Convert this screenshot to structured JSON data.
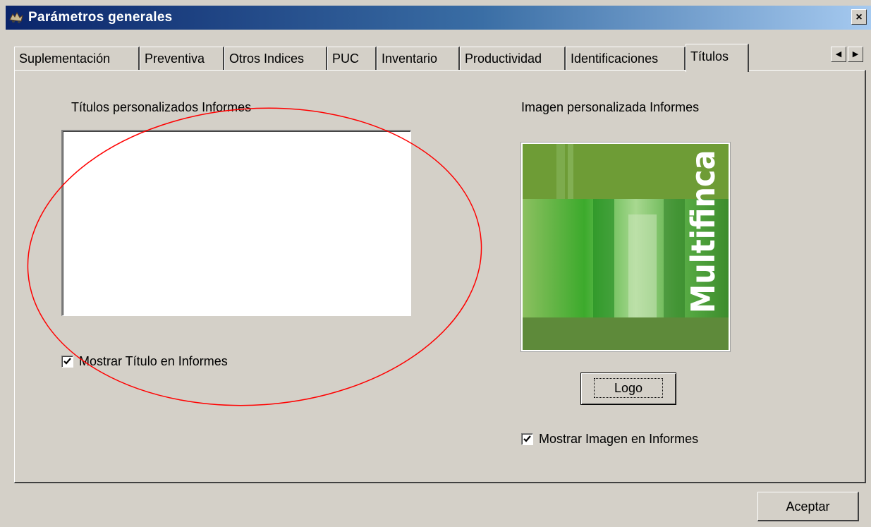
{
  "window": {
    "title": "Parámetros generales",
    "close_label": "×"
  },
  "tabs": [
    {
      "label": "Suplementación",
      "active": false
    },
    {
      "label": "Preventiva",
      "active": false
    },
    {
      "label": "Otros Indices",
      "active": false
    },
    {
      "label": "PUC",
      "active": false
    },
    {
      "label": "Inventario",
      "active": false
    },
    {
      "label": "Productividad",
      "active": false
    },
    {
      "label": "Identificaciones",
      "active": false
    },
    {
      "label": "Títulos",
      "active": true
    }
  ],
  "tab_scroll": {
    "left_icon": "◀",
    "right_icon": "▶"
  },
  "titulos_panel": {
    "custom_titles_label": "Títulos personalizados Informes",
    "custom_titles_value": "",
    "show_title_label": "Mostrar Título en Informes",
    "show_title_checked": true,
    "custom_image_label": "Imagen personalizada Informes",
    "image_text": "Multifinca",
    "logo_button_label": "Logo",
    "show_image_label": "Mostrar Imagen en Informes",
    "show_image_checked": true
  },
  "footer": {
    "accept_label": "Aceptar"
  },
  "colors": {
    "titlebar_start": "#0a246a",
    "titlebar_end": "#a6caf0",
    "dialog_face": "#d4d0c8",
    "annotation_circle": "#ff0000"
  }
}
